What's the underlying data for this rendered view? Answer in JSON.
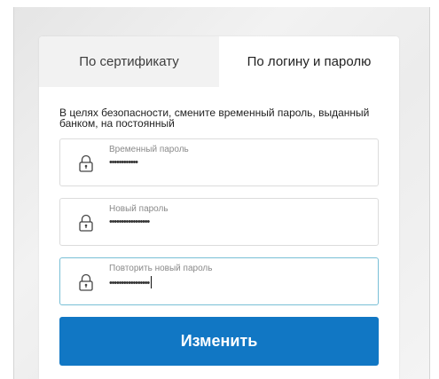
{
  "tabs": [
    {
      "label": "По сертификату",
      "active": false
    },
    {
      "label": "По логину и паролю",
      "active": true
    }
  ],
  "notice": "В целях безопасности, смените временный пароль, выданный банком, на постоянный",
  "fields": [
    {
      "label": "Временный пароль",
      "value": "••••••••••••",
      "icon": "lock-icon"
    },
    {
      "label": "Новый пароль",
      "value": "•••••••••••••••••",
      "icon": "lock-icon"
    },
    {
      "label": "Повторить новый пароль",
      "value": "•••••••••••••••••",
      "icon": "lock-icon",
      "focused": true
    }
  ],
  "submit_label": "Изменить",
  "colors": {
    "primary": "#1177c4",
    "focus_border": "#79bfd6",
    "tab_inactive_bg": "#f2f2f2"
  }
}
